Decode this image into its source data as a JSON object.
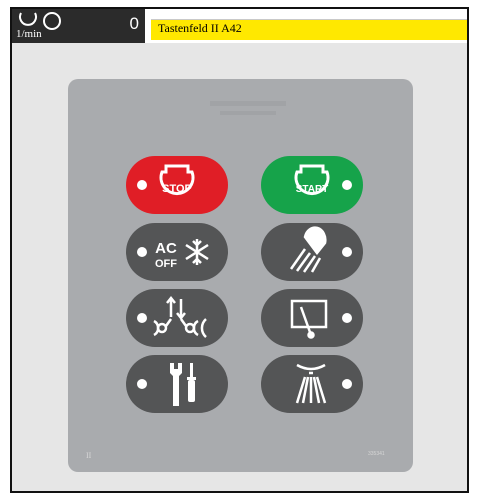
{
  "header": {
    "rpm_value": "0",
    "rpm_unit": "1/min",
    "title": "Tastenfeld II A42"
  },
  "panel": {
    "label_left": "II",
    "label_right": "335341"
  },
  "keys": [
    {
      "id": "stop",
      "label": "STOP",
      "color": "#e01e26"
    },
    {
      "id": "start",
      "label": "START",
      "color": "#16a34a"
    },
    {
      "id": "ac",
      "label_top": "AC",
      "label_bottom": "OFF",
      "color": "#545556"
    },
    {
      "id": "work-light",
      "color": "#545556"
    },
    {
      "id": "beacon",
      "color": "#545556"
    },
    {
      "id": "wiper",
      "color": "#545556"
    },
    {
      "id": "service",
      "color": "#545556"
    },
    {
      "id": "washer",
      "color": "#545556"
    }
  ],
  "colors": {
    "header_bar": "#2b2b2b",
    "title_bar": "#ffe800",
    "panel": "#a9abae",
    "background": "#e6e6e6"
  }
}
